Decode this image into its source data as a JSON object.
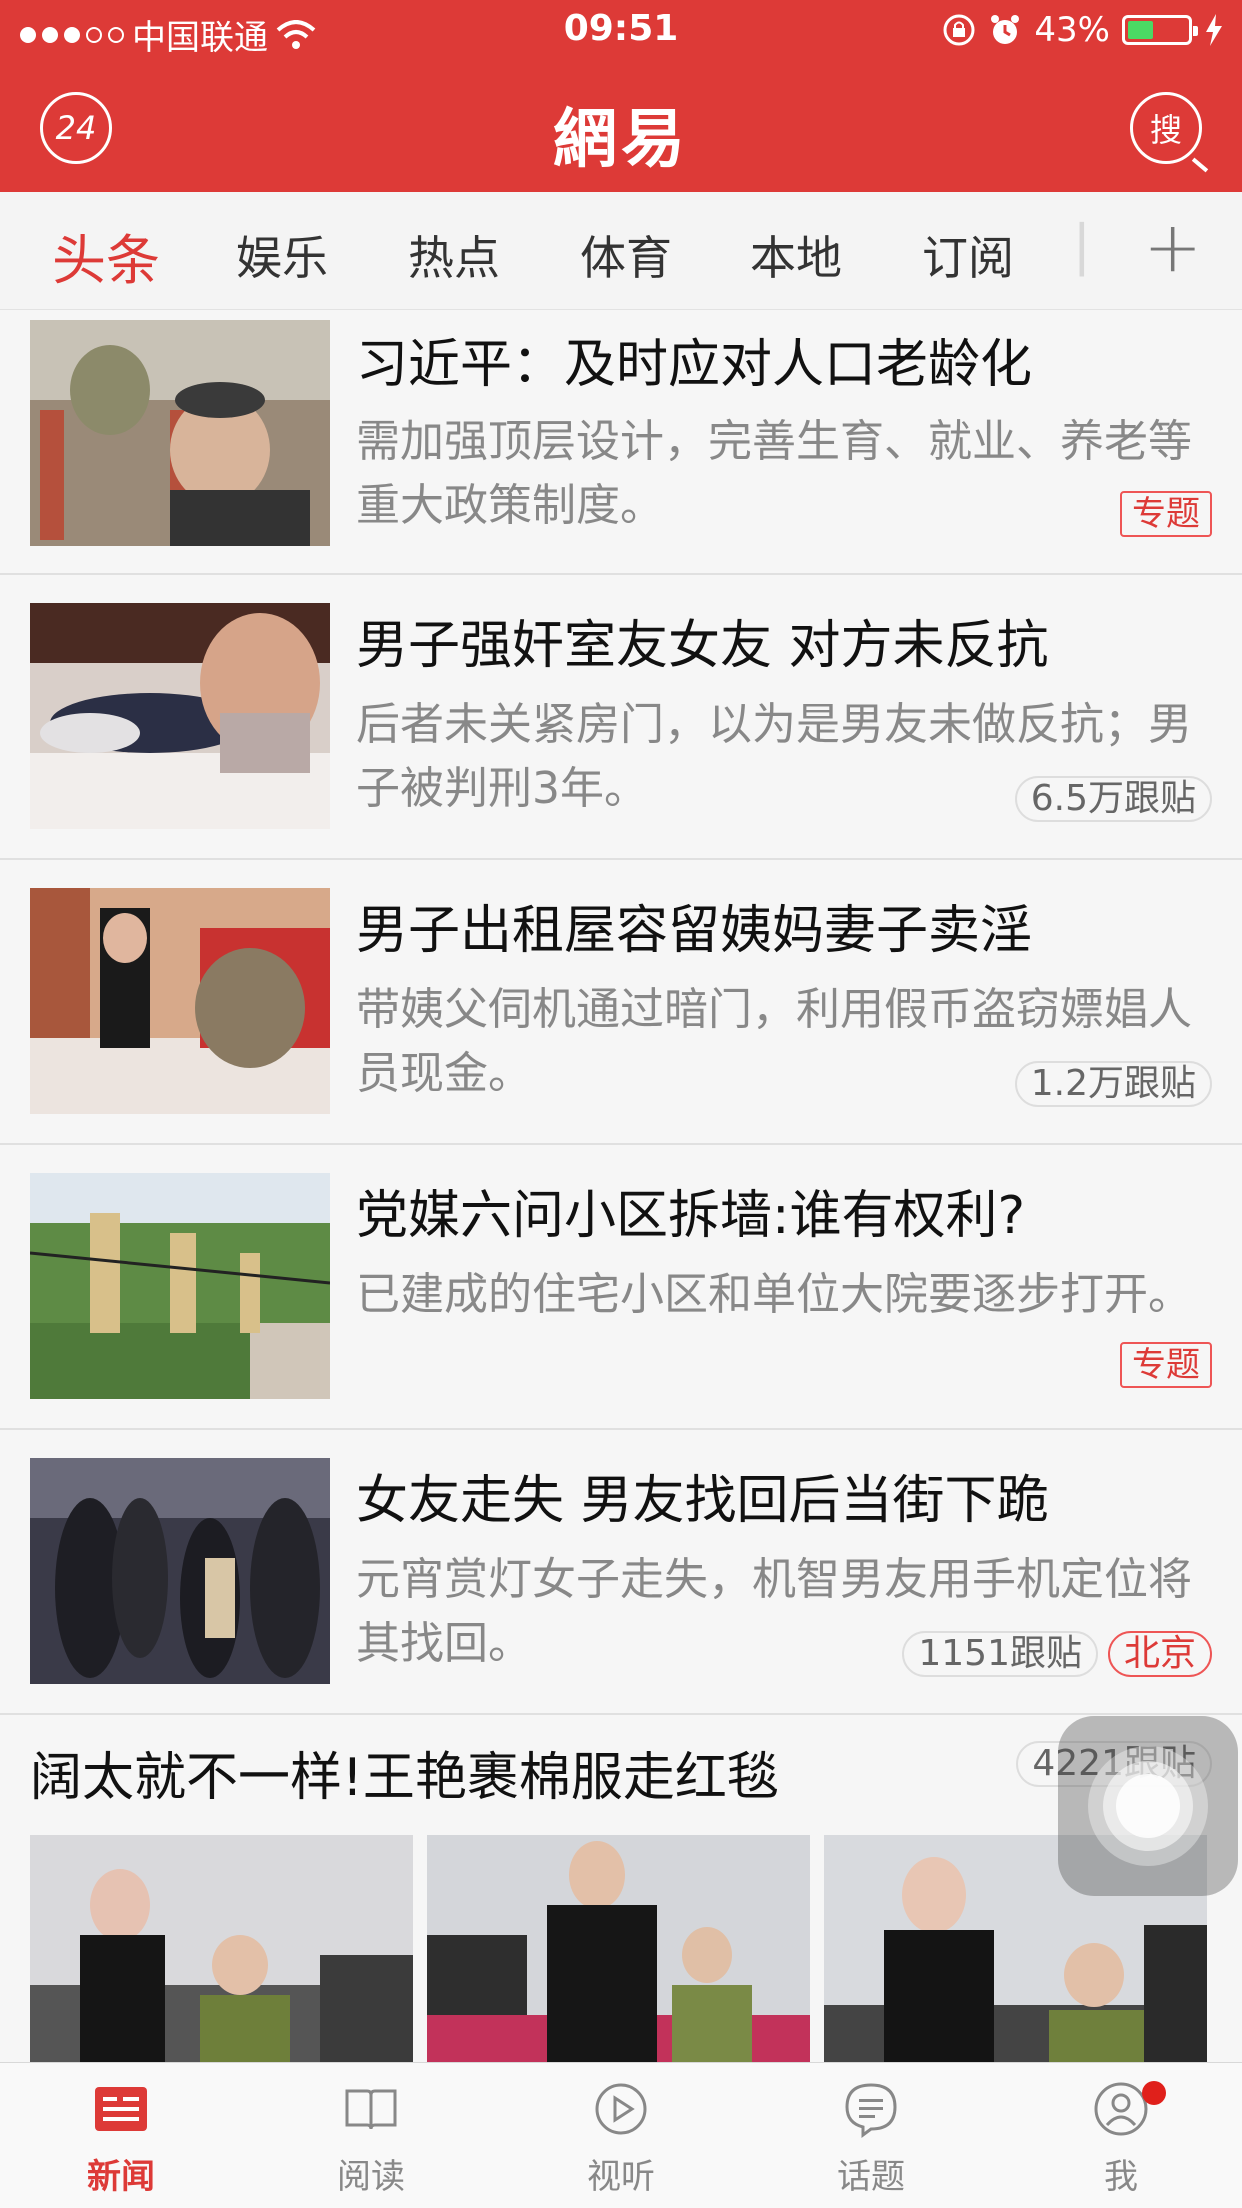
{
  "status_bar": {
    "carrier": "中国联通",
    "time": "09:51",
    "battery": "43%",
    "battery_level": 0.43
  },
  "header": {
    "logo": "網易",
    "left_button": "24",
    "right_button": "搜"
  },
  "tabs": {
    "items": [
      {
        "label": "头条"
      },
      {
        "label": "娱乐"
      },
      {
        "label": "热点"
      },
      {
        "label": "体育"
      },
      {
        "label": "本地"
      },
      {
        "label": "订阅"
      }
    ],
    "add": "+"
  },
  "articles": [
    {
      "title": "习近平：及时应对人口老龄化",
      "desc": "需加强顶层设计，完善生育、就业、养老等重大政策制度。",
      "badge": "专题"
    },
    {
      "title": "男子强奸室友女友 对方未反抗",
      "desc": "后者未关紧房门，以为是男友未做反抗；男子被判刑3年。",
      "comments": "6.5万跟贴"
    },
    {
      "title": "男子出租屋容留姨妈妻子卖淫",
      "desc": "带姨父伺机通过暗门，利用假币盗窃嫖娼人员现金。",
      "comments": "1.2万跟贴"
    },
    {
      "title": "党媒六问小区拆墙:谁有权利?",
      "desc": "已建成的住宅小区和单位大院要逐步打开。",
      "badge": "专题"
    },
    {
      "title": "女友走失 男友找回后当街下跪",
      "desc": "元宵赏灯女子走失，机智男友用手机定位将其找回。",
      "comments": "1151跟贴",
      "location": "北京"
    }
  ],
  "photoset": {
    "title": "阔太就不一样!王艳裹棉服走红毯",
    "comments": "4221跟贴"
  },
  "bottom_nav": {
    "items": [
      {
        "label": "新闻"
      },
      {
        "label": "阅读"
      },
      {
        "label": "视听"
      },
      {
        "label": "话题"
      },
      {
        "label": "我"
      }
    ]
  }
}
